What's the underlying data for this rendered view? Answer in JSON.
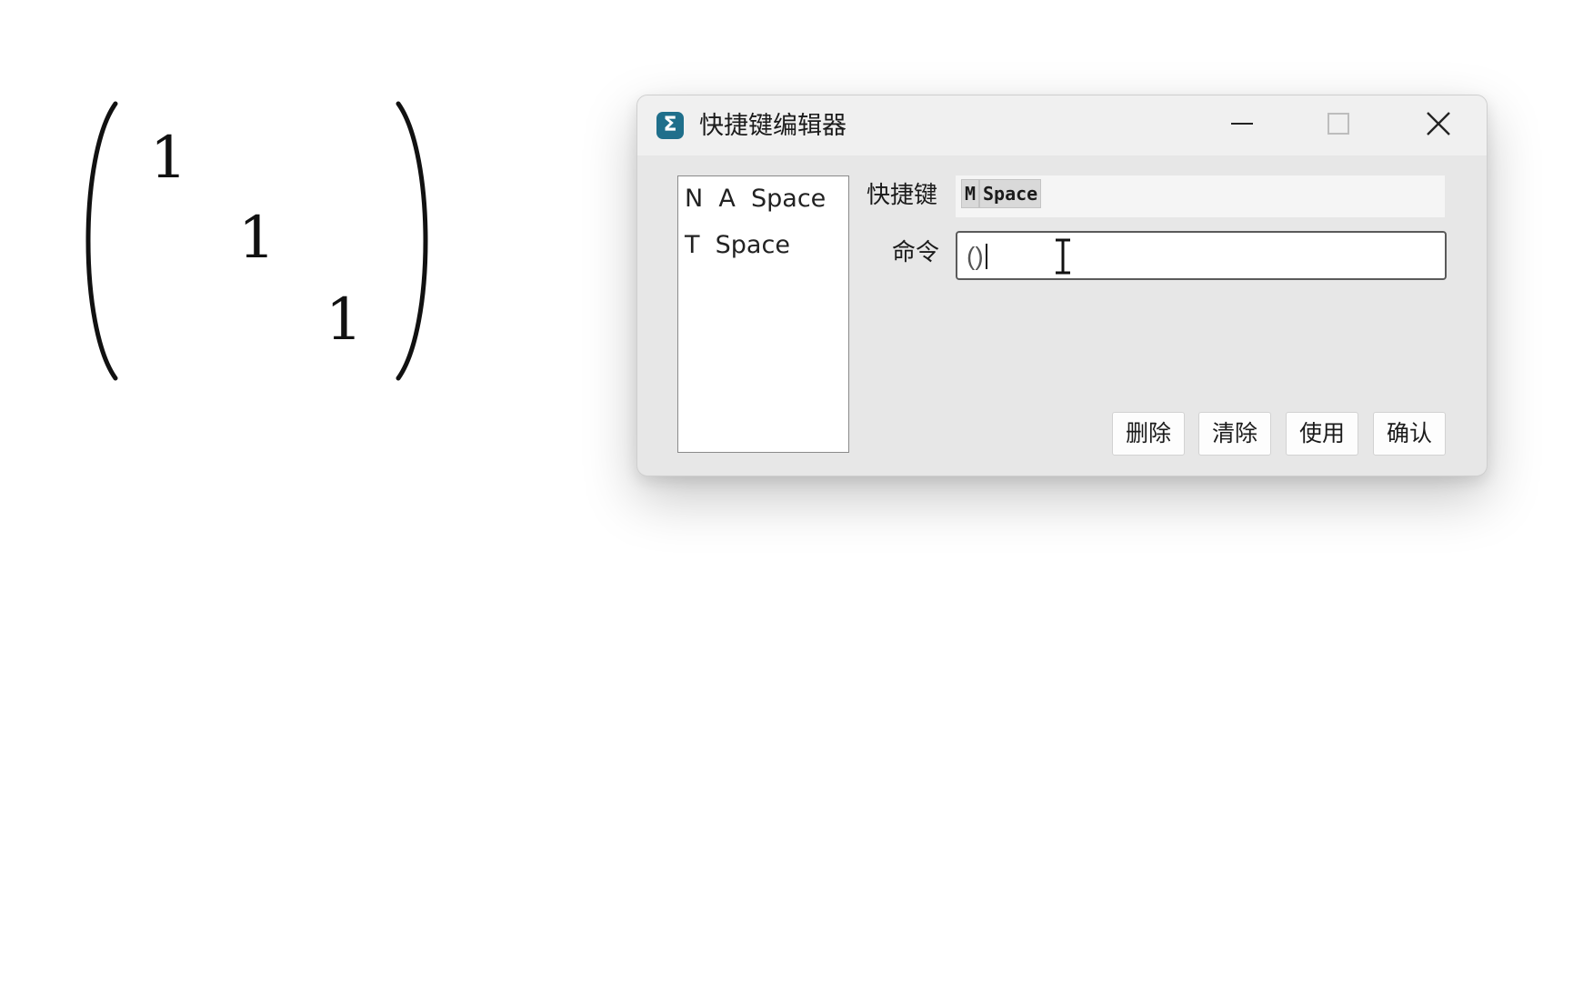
{
  "background": {
    "matrix": {
      "entries": [
        "1",
        "1",
        "1"
      ]
    }
  },
  "dialog": {
    "title": "快捷键编辑器",
    "app_icon": "sigma-icon",
    "window_controls": {
      "minimize": "minimize-icon",
      "maximize": "maximize-icon",
      "close": "close-icon"
    },
    "shortcut_list": [
      "N  A  Space",
      "T  Space"
    ],
    "shortcut_label": "快捷键",
    "shortcut_keys": [
      "M",
      "Space"
    ],
    "command_label": "命令",
    "command_value": "()",
    "buttons": {
      "delete": "删除",
      "clear": "清除",
      "use": "使用",
      "confirm": "确认"
    }
  }
}
